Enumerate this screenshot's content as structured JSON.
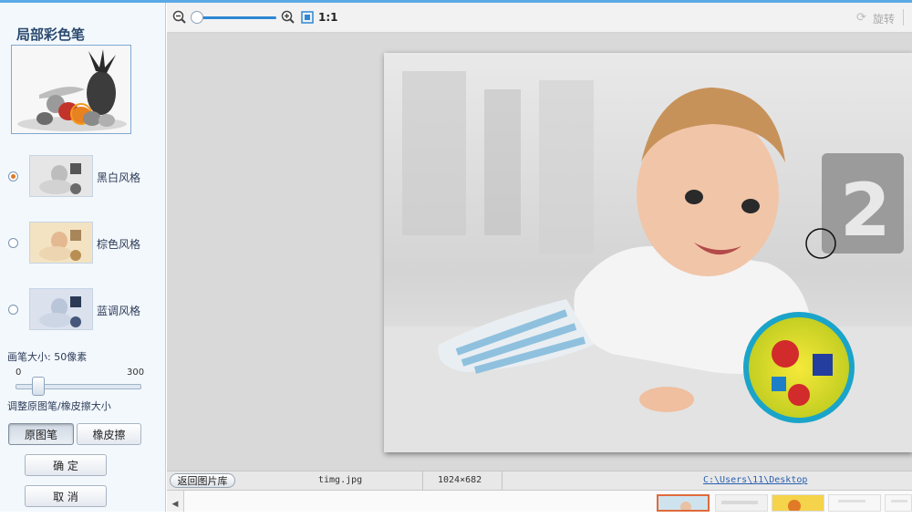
{
  "left_panel": {
    "title": "局部彩色笔",
    "styles": [
      {
        "label": "黑白风格",
        "selected": true
      },
      {
        "label": "棕色风格",
        "selected": false
      },
      {
        "label": "蓝调风格",
        "selected": false
      }
    ],
    "brush_size_label": "画笔大小: 50像素",
    "brush_min": "0",
    "brush_max": "300",
    "brush_value": 50,
    "hint": "调整原图笔/橡皮擦大小",
    "buttons": {
      "original_pen": "原图笔",
      "eraser": "橡皮擦",
      "confirm": "确 定",
      "cancel": "取 消"
    }
  },
  "toolbar": {
    "zoom_one_to_one": "1:1",
    "rotate": "旋转",
    "zoom_level": 0.05
  },
  "status": {
    "back_button": "返回图片库",
    "file_name": "timg.jpg",
    "dimensions": "1024×682",
    "path": "C:\\Users\\11\\Desktop"
  },
  "colors": {
    "accent": "#2d87d4",
    "selected_radio": "#e07a26",
    "path_link": "#2a5fb0"
  }
}
